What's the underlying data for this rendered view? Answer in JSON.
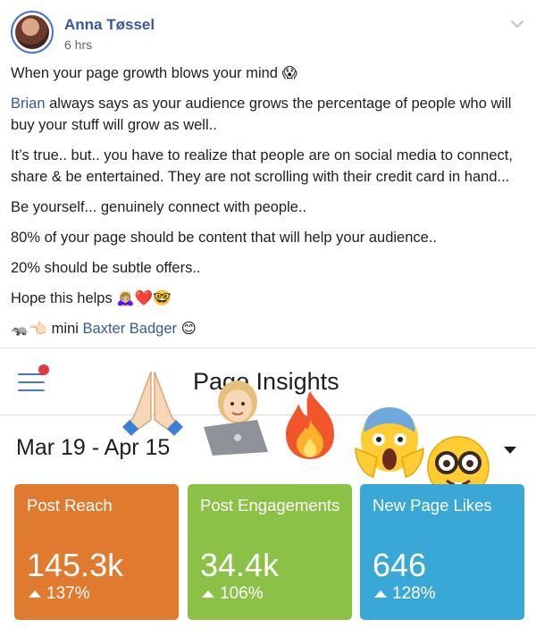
{
  "post": {
    "author": "Anna Tøssel",
    "time": "6 hrs",
    "line1": "When your page growth blows your mind 😱",
    "line2_link": "Brian",
    "line2_rest": " always says as your audience grows the percentage of people who will buy your stuff will grow as well..",
    "line3": "It’s true.. but.. you have to realize that people are on social media to connect, share & be entertained. They are not scrolling with their credit card in hand...",
    "line4": "Be yourself... genuinely connect with people..",
    "line5": "80% of your page should be content that will help your audience..",
    "line6": "20% should be subtle offers..",
    "line7": "Hope this helps 🙇🏼‍♀️❤️🤓",
    "line8_prefix": "🦡👈🏻 mini ",
    "line8_link": "Baxter Badger",
    "line8_suffix": " 😊"
  },
  "insights": {
    "title": "Page Insights",
    "date_range": "Mar 19 - Apr 15",
    "cards": [
      {
        "label": "Post Reach",
        "value": "145.3k",
        "change": "137%",
        "color": "#e07a2e"
      },
      {
        "label": "Post Engagements",
        "value": "34.4k",
        "change": "106%",
        "color": "#8bc146"
      },
      {
        "label": "New Page Likes",
        "value": "646",
        "change": "128%",
        "color": "#3aa8d6"
      }
    ]
  },
  "icons": {
    "hamburger": "menu-icon",
    "notification": "red-dot-icon",
    "chevron": "chevron-down-icon",
    "overlay_emojis": [
      "folded-hands-emoji",
      "technologist-emoji",
      "fire-emoji",
      "screaming-face-emoji",
      "nerd-face-emoji"
    ]
  }
}
